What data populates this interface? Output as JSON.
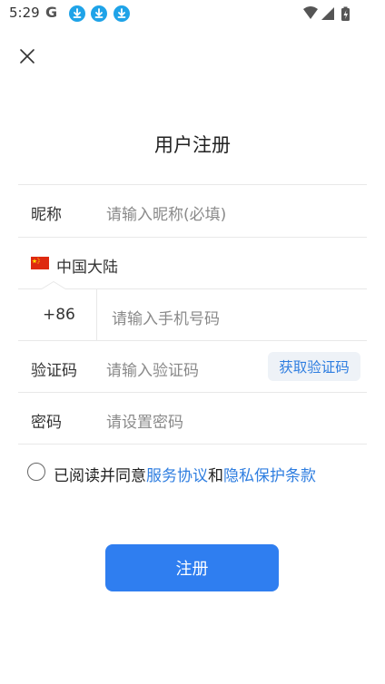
{
  "status_bar": {
    "time": "5:29",
    "g_logo": "G",
    "notification_icons": [
      "download-icon",
      "download-icon",
      "download-icon"
    ],
    "system_icons": [
      "wifi-icon",
      "signal-icon",
      "battery-charging-icon"
    ]
  },
  "page": {
    "title": "用户注册"
  },
  "form": {
    "nickname_label": "昵称",
    "nickname_placeholder": "请输入昵称(必填)",
    "region": "中国大陆",
    "country_code": "+86",
    "phone_placeholder": "请输入手机号码",
    "code_label": "验证码",
    "code_placeholder": "请输入验证码",
    "get_code_button": "获取验证码",
    "password_label": "密码",
    "password_placeholder": "请设置密码"
  },
  "agreement": {
    "prefix": "已阅读并同意",
    "service_link": "服务协议",
    "and": "和",
    "privacy_link": "隐私保护条款",
    "checked": false
  },
  "submit_label": "注册",
  "colors": {
    "accent": "#2f7ef0",
    "link": "#2f7ee0",
    "flag_red": "#de2910"
  }
}
